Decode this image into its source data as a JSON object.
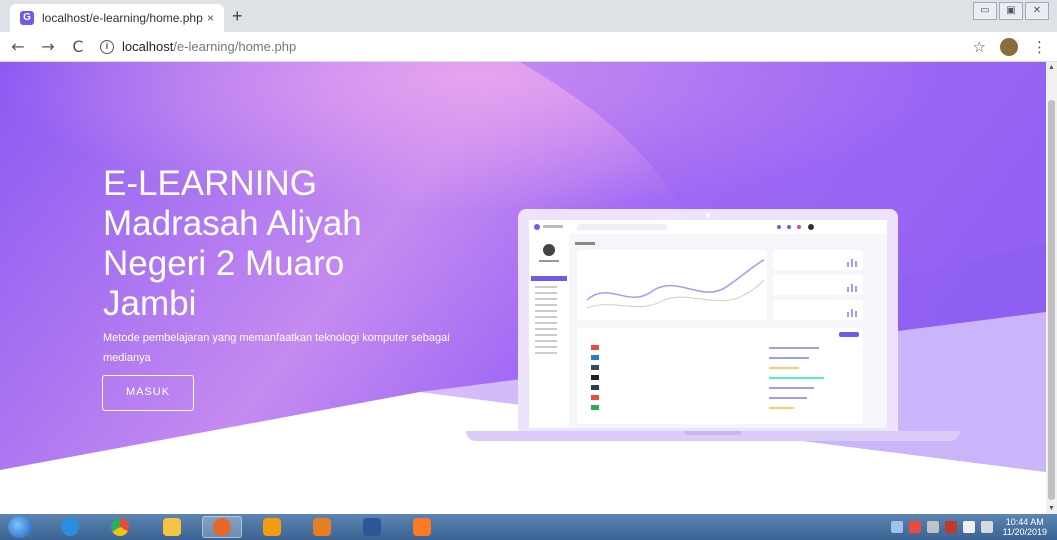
{
  "browser": {
    "tab_title": "localhost/e-learning/home.php",
    "tab_close": "×",
    "new_tab": "+",
    "url_host": "localhost",
    "url_path": "/e-learning/home.php",
    "back": "←",
    "forward": "→",
    "reload": "C",
    "bookmark": "☆",
    "menu": "⋮"
  },
  "window_controls": {
    "minimize": "▭",
    "maximize": "▣",
    "close": "✕"
  },
  "hero": {
    "title_line1": "E-LEARNING",
    "title_line2": "Madrasah Aliyah",
    "title_line3": "Negeri 2 Muaro",
    "title_line4": "Jambi",
    "description": "Metode pembelajaran yang memanfaatkan teknologi komputer sebagai medianya",
    "button_label": "MASUK"
  },
  "colors": {
    "hero_start": "#8b5cf6",
    "hero_end": "#b37cf3",
    "accent": "#6c5ce7"
  },
  "taskbar": {
    "apps": [
      "ie-icon",
      "chrome-icon",
      "explorer-icon",
      "firefox-icon",
      "sublime-icon",
      "media-player-icon",
      "word-icon",
      "xampp-icon"
    ],
    "time": "10:44 AM",
    "date": "11/20/2019"
  }
}
